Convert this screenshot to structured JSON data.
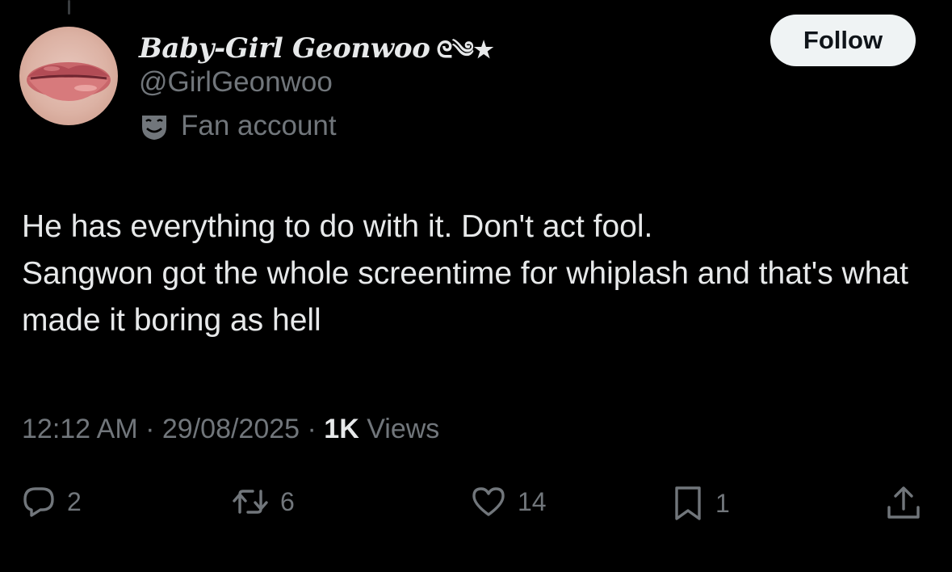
{
  "tweet": {
    "author": {
      "display_name": "Baby-Girl Geonwoo",
      "name_decoration": "ᘓ༄★",
      "handle": "@GirlGeonwoo",
      "label": "Fan account",
      "label_icon": "theater-mask-icon"
    },
    "follow_label": "Follow",
    "text": "He has everything to do with it. Don't act fool.\nSangwon got the whole screentime for whiplash and that's what made it boring as hell",
    "meta": {
      "time": "12:12 AM",
      "separator": "·",
      "date": "29/08/2025",
      "views_count": "1K",
      "views_label": "Views"
    },
    "actions": {
      "replies": "2",
      "reposts": "6",
      "likes": "14",
      "bookmarks": "1"
    }
  },
  "colors": {
    "background": "#000000",
    "text_primary": "#e7e9ea",
    "text_secondary": "#71767b",
    "follow_bg": "#eff3f4"
  }
}
